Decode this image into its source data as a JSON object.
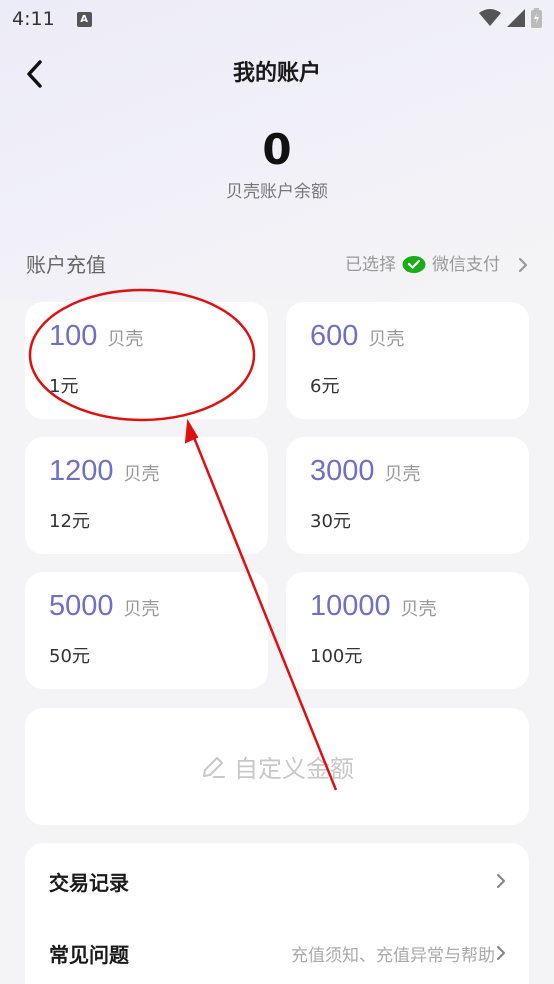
{
  "status_bar": {
    "time": "4:11",
    "notif_letter": "A"
  },
  "header": {
    "title": "我的账户"
  },
  "balance": {
    "value": "0",
    "label": "贝壳账户余额"
  },
  "recharge": {
    "section_title": "账户充值",
    "payment_selected_prefix": "已选择",
    "payment_method": "微信支付",
    "packages": [
      {
        "amount": "100",
        "unit": "贝壳",
        "price": "1元"
      },
      {
        "amount": "600",
        "unit": "贝壳",
        "price": "6元"
      },
      {
        "amount": "1200",
        "unit": "贝壳",
        "price": "12元"
      },
      {
        "amount": "3000",
        "unit": "贝壳",
        "price": "30元"
      },
      {
        "amount": "5000",
        "unit": "贝壳",
        "price": "50元"
      },
      {
        "amount": "10000",
        "unit": "贝壳",
        "price": "100元"
      }
    ],
    "custom_label": "自定义金额"
  },
  "menu": [
    {
      "label": "交易记录",
      "hint": ""
    },
    {
      "label": "常见问题",
      "hint": "充值须知、充值异常与帮助"
    }
  ],
  "colors": {
    "accent": "#6f6fc5",
    "wechat": "#1aad19",
    "annotation": "#e01010"
  }
}
